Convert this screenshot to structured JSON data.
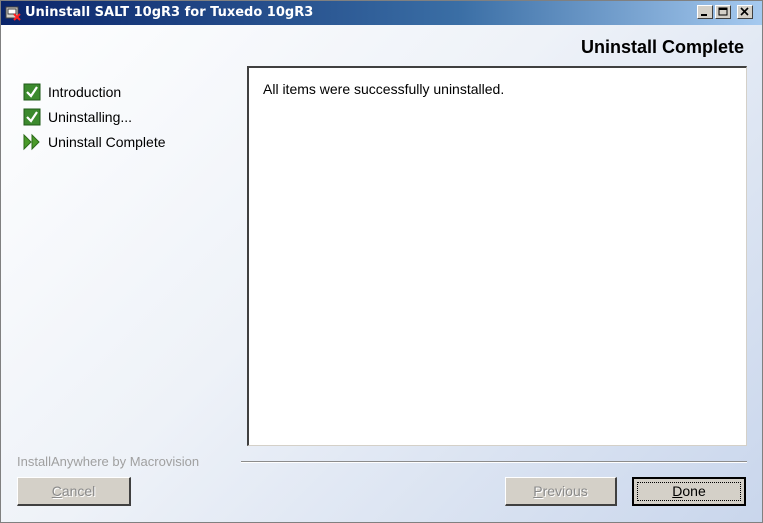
{
  "window": {
    "title": "Uninstall SALT 10gR3 for Tuxedo 10gR3",
    "icon": "installer-app-icon",
    "controls": {
      "minimize": "minimize-icon",
      "maximize": "maximize-icon",
      "close": "close-icon"
    }
  },
  "header": {
    "title": "Uninstall Complete"
  },
  "steps": [
    {
      "label": "Introduction",
      "status": "done",
      "icon": "check-icon"
    },
    {
      "label": "Uninstalling...",
      "status": "done",
      "icon": "check-icon"
    },
    {
      "label": "Uninstall Complete",
      "status": "current",
      "icon": "arrow-current-icon"
    }
  ],
  "content": {
    "message": "All items were successfully uninstalled."
  },
  "footer": {
    "brand": "InstallAnywhere by Macrovision",
    "buttons": {
      "cancel": {
        "label_first": "C",
        "label_rest": "ancel",
        "enabled": false
      },
      "previous": {
        "label_first": "P",
        "label_rest": "revious",
        "enabled": false
      },
      "done": {
        "label_first": "D",
        "label_rest": "one",
        "enabled": true
      }
    }
  },
  "colors": {
    "titlebar_start": "#0a246a",
    "titlebar_end": "#a6caf0",
    "check_green": "#3c8a2e",
    "arrow_green": "#4a9a2a",
    "button_face": "#d4d0c8"
  }
}
